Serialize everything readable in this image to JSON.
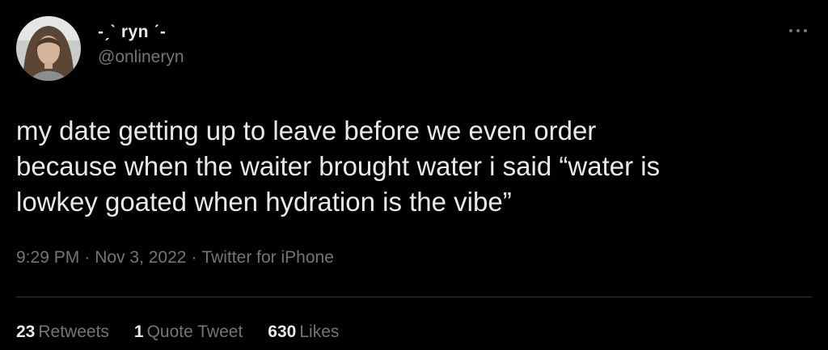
{
  "author": {
    "display_name": "-ˏˋ ryn ˊ-",
    "handle": "@onlineryn"
  },
  "tweet": {
    "text": "my date getting up to leave before we even order\nbecause when the waiter brought water i said “water is\nlowkey goated when hydration is the vibe”"
  },
  "meta": {
    "time": "9:29 PM",
    "separator": "·",
    "date": "Nov 3, 2022",
    "source": "Twitter for iPhone"
  },
  "stats": {
    "retweets": {
      "count": "23",
      "label": "Retweets"
    },
    "quote_tweets": {
      "count": "1",
      "label": "Quote Tweet"
    },
    "likes": {
      "count": "630",
      "label": "Likes"
    }
  },
  "icons": {
    "more": "more-horizontal-icon",
    "avatar": "profile-photo"
  },
  "colors": {
    "background": "#000000",
    "primary_text": "#e7e9ea",
    "secondary_text": "#71767b",
    "divider": "#2f3336"
  }
}
